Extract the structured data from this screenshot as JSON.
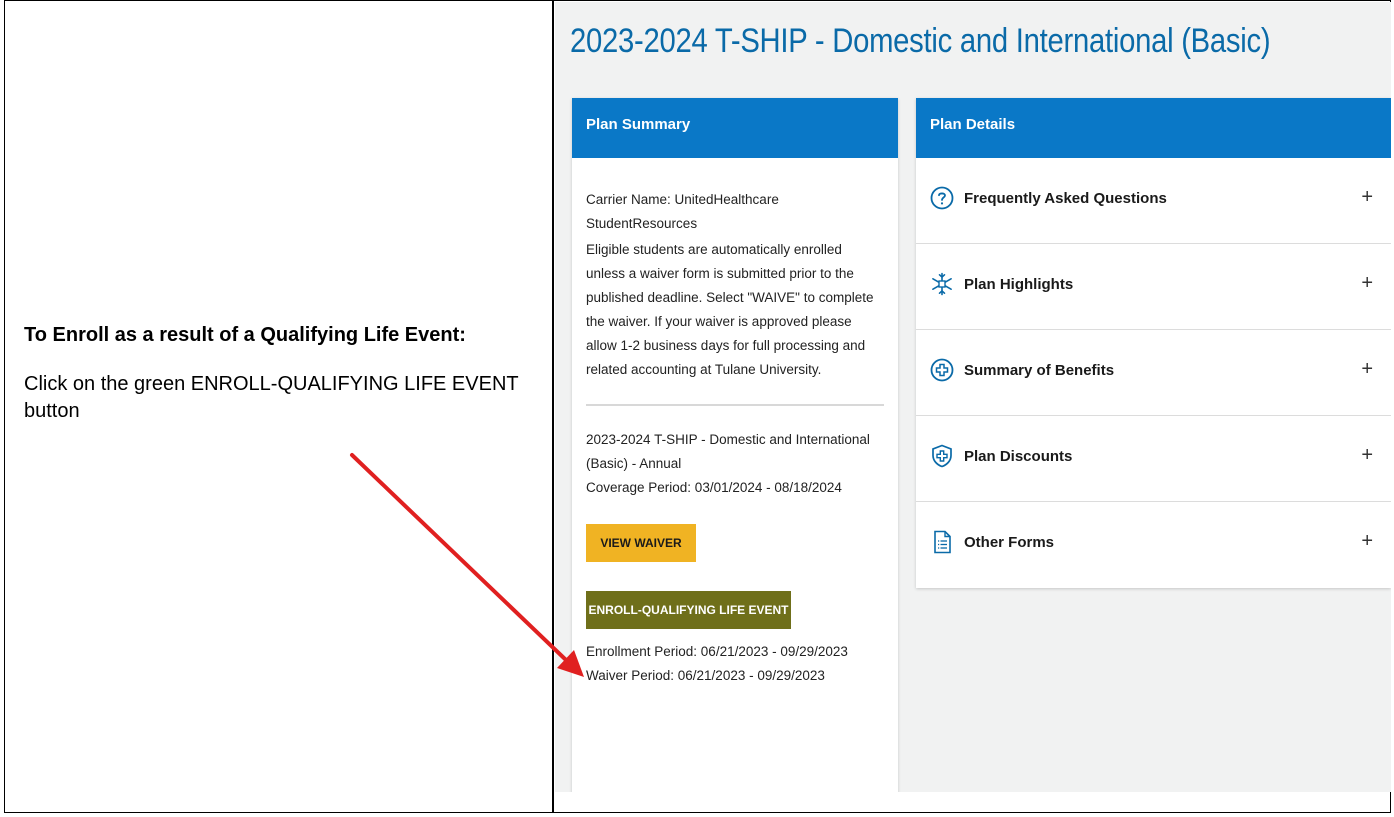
{
  "instructions": {
    "title": "To Enroll as a result of a Qualifying Life Event:",
    "body": "Click on the green ENROLL-QUALIFYING LIFE EVENT button"
  },
  "page": {
    "title": "2023-2024 T-SHIP - Domestic and International (Basic)"
  },
  "plan_summary": {
    "header": "Plan Summary",
    "carrier": "Carrier Name: UnitedHealthcare StudentResources",
    "description": "Eligible students are automatically enrolled unless a waiver form is submitted prior to the published deadline. Select \"WAIVE\" to complete the waiver. If your waiver is approved please allow 1-2 business days for full processing and related accounting at Tulane University.",
    "plan_name": "2023-2024 T-SHIP - Domestic and International (Basic) - Annual",
    "coverage_period": "Coverage Period: 03/01/2024 - 08/18/2024",
    "view_waiver_label": "VIEW WAIVER",
    "enroll_label": "ENROLL-QUALIFYING LIFE EVENT",
    "enrollment_period": "Enrollment Period: 06/21/2023 - 09/29/2023",
    "waiver_period": "Waiver Period: 06/21/2023 - 09/29/2023"
  },
  "plan_details": {
    "header": "Plan Details",
    "items": [
      {
        "label": "Frequently Asked Questions",
        "icon": "question-circle-icon",
        "toggle": "+"
      },
      {
        "label": "Plan Highlights",
        "icon": "medical-snowflake-icon",
        "toggle": "+"
      },
      {
        "label": "Summary of Benefits",
        "icon": "medical-cross-circle-icon",
        "toggle": "+"
      },
      {
        "label": "Plan Discounts",
        "icon": "shield-cross-icon",
        "toggle": "+"
      },
      {
        "label": "Other Forms",
        "icon": "document-list-icon",
        "toggle": "+"
      }
    ]
  },
  "colors": {
    "title_blue": "#0a6aa8",
    "header_blue": "#0a78c7",
    "waiver_yellow": "#f0b323",
    "enroll_olive": "#6f6f1a",
    "arrow_red": "#e02020"
  }
}
